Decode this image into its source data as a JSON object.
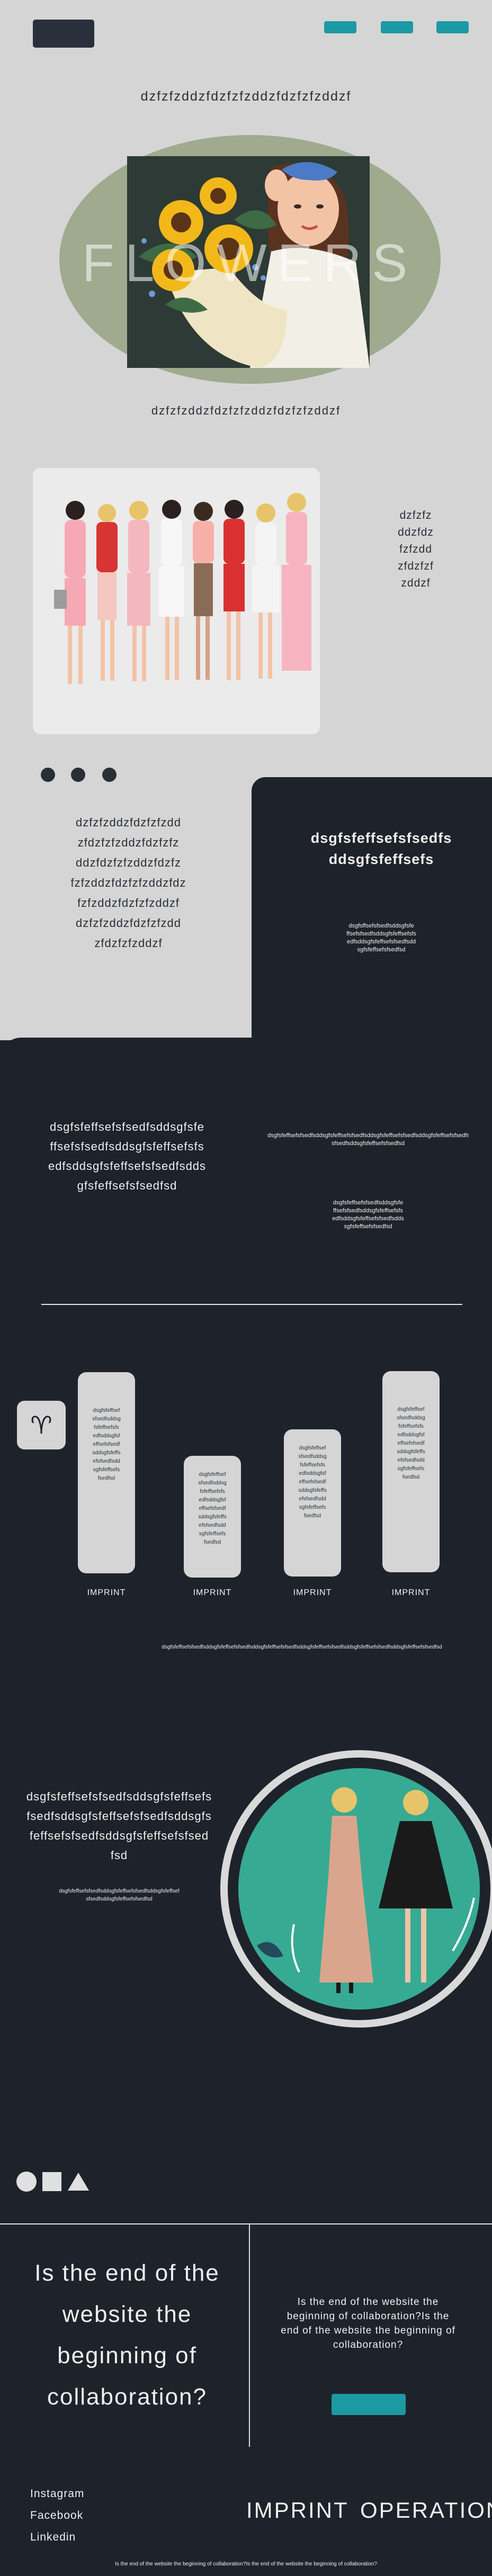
{
  "header": {
    "nav_buttons": [
      "",
      "",
      ""
    ],
    "title": "dzfzfzddzfdzfzfzddzfdzfzfzddzf"
  },
  "hero": {
    "flowers_word": "FLOWERS",
    "caption": "dzfzfzddzfdzfzfzddzfdzfzfzddzf"
  },
  "group_section": {
    "side_lines": [
      "dzfzfz",
      "ddzfdz",
      "fzfzdd",
      "zfdzfzf",
      "zddzf"
    ]
  },
  "dots_section": {
    "text_lines": [
      "dzfzfzddzfdzfzfzdd",
      "zfdzfzfzddzfdzfzfz",
      "ddzfdzfzfzddzfdzfz",
      "fzfzddzfdzfzfzddzfdz",
      "fzfzddzfdzfzfzddzf",
      "dzfzfzddzfdzfzfzdd",
      "zfdzfzfzddzf"
    ],
    "card_title_lines": [
      "dsgfsfeffsefsfsedfs",
      "ddsgfsfeffsefs"
    ],
    "card_small_lines": [
      "dsgfsffsefsfsedfsddsgfsfe",
      "ffsefsfsedfsddsgfsfeffsefsfs",
      "edfsddsgfsfeffsefsfsedfsdd",
      "sgfsfeffsefsfsedfsd"
    ]
  },
  "dark_section": {
    "heading_lines": [
      "dsgfsfeffsefsfsedfsddsgfsfe",
      "ffsefsfsedfsddsgfsfeffsefsfs",
      "edfsddsgfsfeffsefsfsedfsdds",
      "gfsfeffsefsfsedfsd"
    ],
    "right_long": "dsgfsfeffsefsfsedfsddsgfsfeffsefsfsedfsddsgfsfeffsefsfsedfsddsgfsfeffsefsfsedfsddsgfsfeffsef",
    "right_long2": "sfsedfsddsgfsfeffsefsfsedfsd",
    "right_small_lines": [
      "dsgfsfeffsefsfsedfsddsgfsfe",
      "ffsefsfsedfsddsgfsfeffsefsfs",
      "edfsddsgfsfeffsefsfsedfsdds",
      "sgfsfeffsefsfsedfsd"
    ]
  },
  "zodiac_symbol": "♈",
  "pills": [
    {
      "text_lines": [
        "dsgfsfeffsef",
        "sfsedfsddsg",
        "fsfeffsefsfs",
        "edfsddsgfsf",
        "effsefsfsedf",
        "sddsgfsfeffs",
        "efsfsedfsdd",
        "sgfsfeffsefs",
        "fsedfsd"
      ],
      "label": "IMPRINT"
    },
    {
      "text_lines": [
        "dsgfsfeffsef",
        "sfsedfsddsg",
        "fsfeffsefsfs",
        "edfsddsgfsf",
        "effsefsfsedf",
        "sddsgfsfeffs",
        "efsfsedfsdd",
        "sgfsfeffsefs",
        "fsedfsd"
      ],
      "label": "IMPRINT"
    },
    {
      "text_lines": [
        "dsgfsfeffsef",
        "sfsedfsddsg",
        "fsfeffsefsfs",
        "edfsddsgfsf",
        "effsefsfsedf",
        "sddsgfsfeffs",
        "efsfsedfsdd",
        "sgfsfeffsefs",
        "fsedfsd"
      ],
      "label": "IMPRINT"
    },
    {
      "text_lines": [
        "dsgfsfeffsef",
        "sfsedfsddsg",
        "fsfeffsefsfs",
        "edfsddsgfsf",
        "effsefsfsedf",
        "sddsgfsfeffs",
        "efsfsedfsdd",
        "sgfsfeffsefs",
        "fsedfsd"
      ],
      "label": "IMPRINT"
    }
  ],
  "pills_footer": "dsgfsfeffsefsfsedfsddsgfsfeffsefsfsedfsddsgfsfeffsefsfsedfsddsgfsfeffsefsfsedfsddsgfsfeffsefsfsedfsddsgfsfeffsefsfsedfsd",
  "women_section": {
    "heading_lines": [
      "dsgfsfeffsefsfsedfsddsgfsfeffsefs",
      "fsedfsddsgfsfeffsefsfsedfsddsgfs",
      "feffsefsfsedfsddsgfsfeffsefsfsed",
      "fsd"
    ],
    "small_lines": [
      "dsgfsfeffsefsfsedfsddsgfsfeffsefsfsedfsddsgfsfeffsef",
      "sfsedfsddsgfsfeffsefsfsedfsd"
    ]
  },
  "collab": {
    "big_lines": [
      "Is the end of the",
      "website the",
      "beginning of",
      "collaboration?"
    ],
    "small_lines": [
      "Is the end of the website the",
      "beginning of collaboration?Is the",
      "end of the website the beginning of",
      "collaboration?"
    ],
    "button_label": ""
  },
  "footer": {
    "links": [
      "Instagram",
      "Facebook",
      "Linkedin"
    ],
    "imprint": "IMPRINT",
    "operation": "OPERATION",
    "bottom_line": "Is the end of the website the beginning of collaboration?Is the end of the website the beginning of collaboration?"
  },
  "colors": {
    "teal": "#1b9aa3",
    "dark": "#1e232b",
    "light": "#d5d5d5",
    "sage": "#9faa8f"
  }
}
